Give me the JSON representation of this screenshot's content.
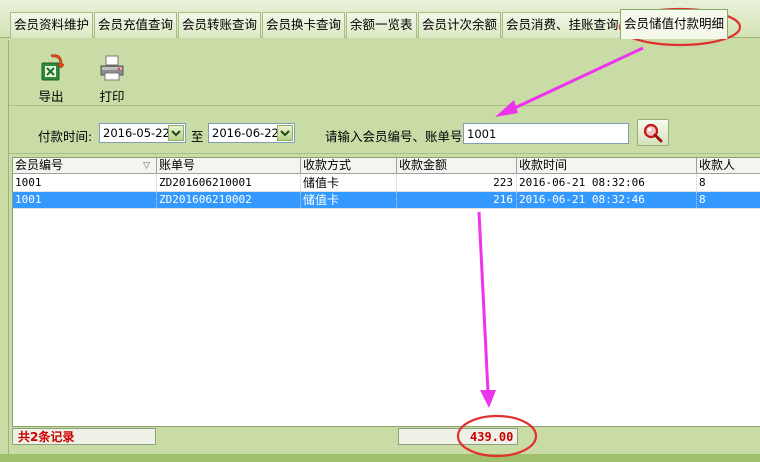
{
  "tabs": [
    {
      "label": "会员资料维护"
    },
    {
      "label": "会员充值查询"
    },
    {
      "label": "会员转账查询"
    },
    {
      "label": "会员换卡查询"
    },
    {
      "label": "余额一览表"
    },
    {
      "label": "会员计次余额"
    },
    {
      "label": "会员消费、挂账查询"
    },
    {
      "label": "会员储值付款明细"
    }
  ],
  "active_tab": "会员储值付款明细",
  "toolbar": {
    "export_label": "导出",
    "print_label": "打印"
  },
  "filter": {
    "time_label": "付款时间:",
    "start_date": "2016-05-22",
    "to_label": "至",
    "end_date": "2016-06-22",
    "search_label": "请输入会员编号、账单号",
    "search_value": "1001"
  },
  "table": {
    "columns": [
      "会员编号",
      "账单号",
      "收款方式",
      "收款金额",
      "收款时间",
      "收款人"
    ],
    "rows": [
      {
        "member_id": "1001",
        "bill_no": "ZD201606210001",
        "method": "储值卡",
        "amount": "223",
        "time": "2016-06-21 08:32:06",
        "cashier": "8"
      },
      {
        "member_id": "1001",
        "bill_no": "ZD201606210002",
        "method": "储值卡",
        "amount": "216",
        "time": "2016-06-21 08:32:46",
        "cashier": "8"
      }
    ],
    "selected_row": 1
  },
  "footer": {
    "record_count": "共2条记录",
    "total_amount": "439.00"
  },
  "colors": {
    "background": "#c9dca6",
    "selection": "#3399ff",
    "total_text": "#cc0000",
    "annotation": "#ee33ee",
    "highlight_circle": "#e03030"
  },
  "icons": {
    "export": "export-excel-icon",
    "print": "printer-icon",
    "search": "magnifier-icon"
  }
}
